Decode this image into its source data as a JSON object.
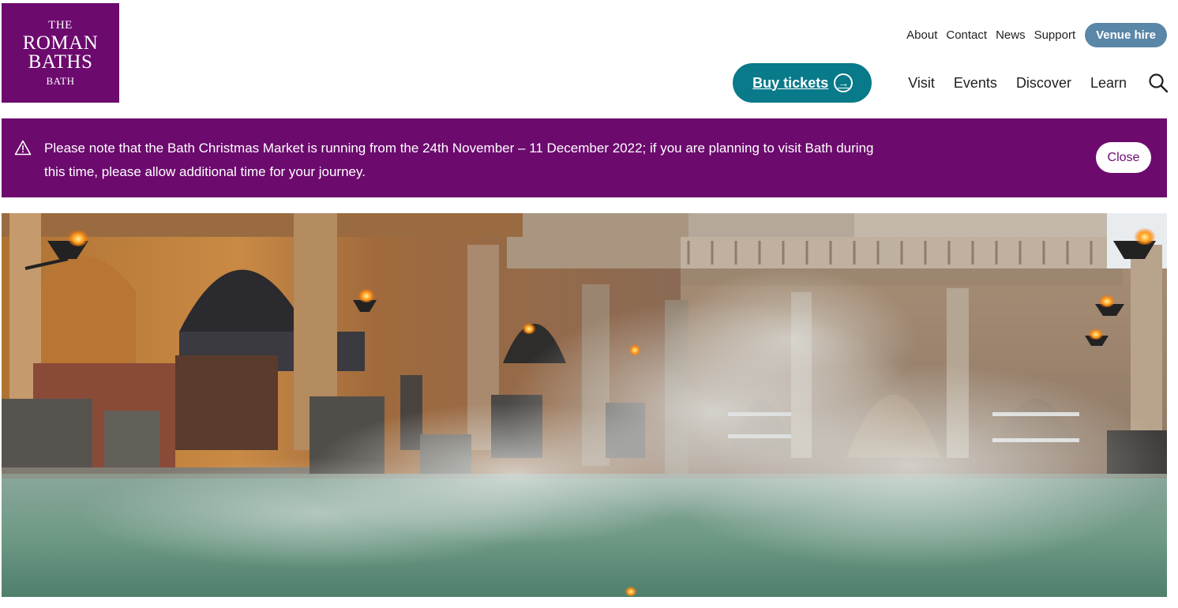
{
  "logo": {
    "line1": "THE",
    "line2": "ROMAN",
    "line3": "BATHS",
    "line4": "BATH"
  },
  "util_nav": {
    "about": "About",
    "contact": "Contact",
    "news": "News",
    "support": "Support",
    "venue_hire": "Venue hire"
  },
  "main_nav": {
    "buy_tickets": "Buy tickets",
    "visit": "Visit",
    "events": "Events",
    "discover": "Discover",
    "learn": "Learn"
  },
  "alert": {
    "message": "Please note that the Bath Christmas Market is running from the 24th November – 11 December 2022; if you are planning to visit Bath during this time, please allow additional time for your journey.",
    "close_label": "Close"
  },
  "icons": {
    "buy_arrow": "arrow-circle-icon",
    "search": "search-icon",
    "warning": "warning-triangle-icon"
  },
  "colors": {
    "brand_purple": "#6c0a6e",
    "ticket_teal": "#087a8a",
    "venue_blue": "#5a86a8"
  }
}
